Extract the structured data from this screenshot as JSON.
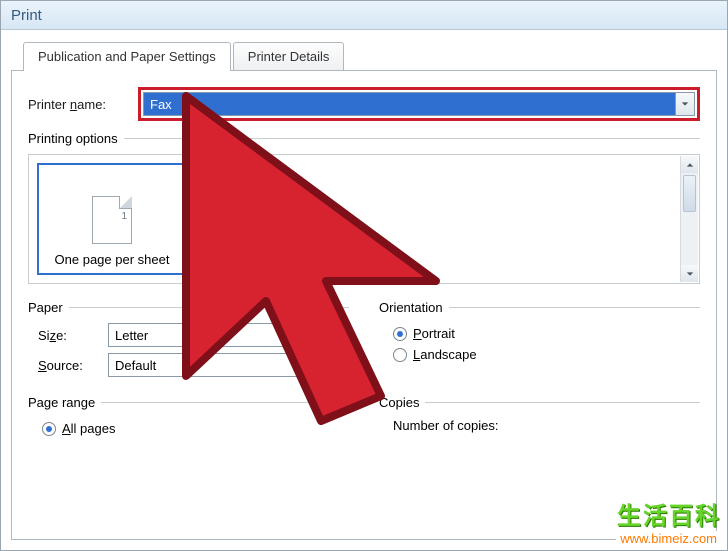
{
  "window": {
    "title": "Print"
  },
  "tabs": {
    "publication": "Publication and Paper Settings",
    "details": "Printer Details"
  },
  "printer": {
    "label_pre": "Printer ",
    "label_u": "n",
    "label_post": "ame:",
    "value": "Fax"
  },
  "printing_options": {
    "title": "Printing options",
    "tile_label": "One page per sheet",
    "page_number": "1"
  },
  "paper": {
    "title": "Paper",
    "size_pre": "Si",
    "size_u": "z",
    "size_post": "e:",
    "size_value": "Letter",
    "source_u": "S",
    "source_post": "ource:",
    "source_value": "Default"
  },
  "orientation": {
    "title": "Orientation",
    "portrait_u": "P",
    "portrait_post": "ortrait",
    "landscape_u": "L",
    "landscape_post": "andscape"
  },
  "page_range": {
    "title": "Page range",
    "all_u": "A",
    "all_post": "ll pages"
  },
  "copies": {
    "title": "Copies",
    "number_label": "Number of copies:"
  },
  "watermark": {
    "cn": "生活百科",
    "url": "www.bimeiz.com"
  }
}
